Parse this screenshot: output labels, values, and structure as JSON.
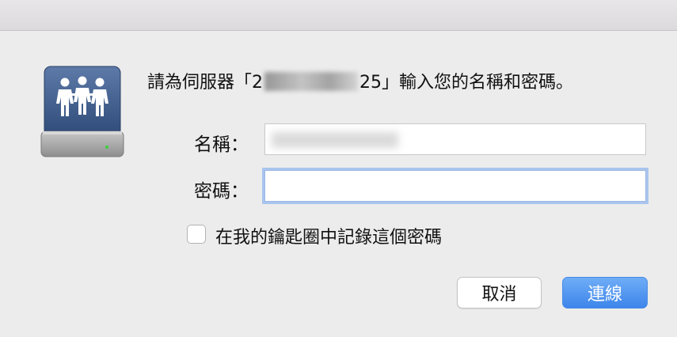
{
  "dialog": {
    "prompt_prefix": "請為伺服器「2",
    "prompt_suffix": "25」輸入您的名稱和密碼。",
    "icon": "shared-server-icon"
  },
  "form": {
    "name_label": "名稱：",
    "password_label": "密碼：",
    "remember_label": "在我的鑰匙圈中記錄這個密碼"
  },
  "buttons": {
    "cancel": "取消",
    "connect": "連線"
  },
  "colors": {
    "accent": "#3d85ea",
    "focus_ring": "#a9c5ee",
    "background": "#ececec"
  }
}
